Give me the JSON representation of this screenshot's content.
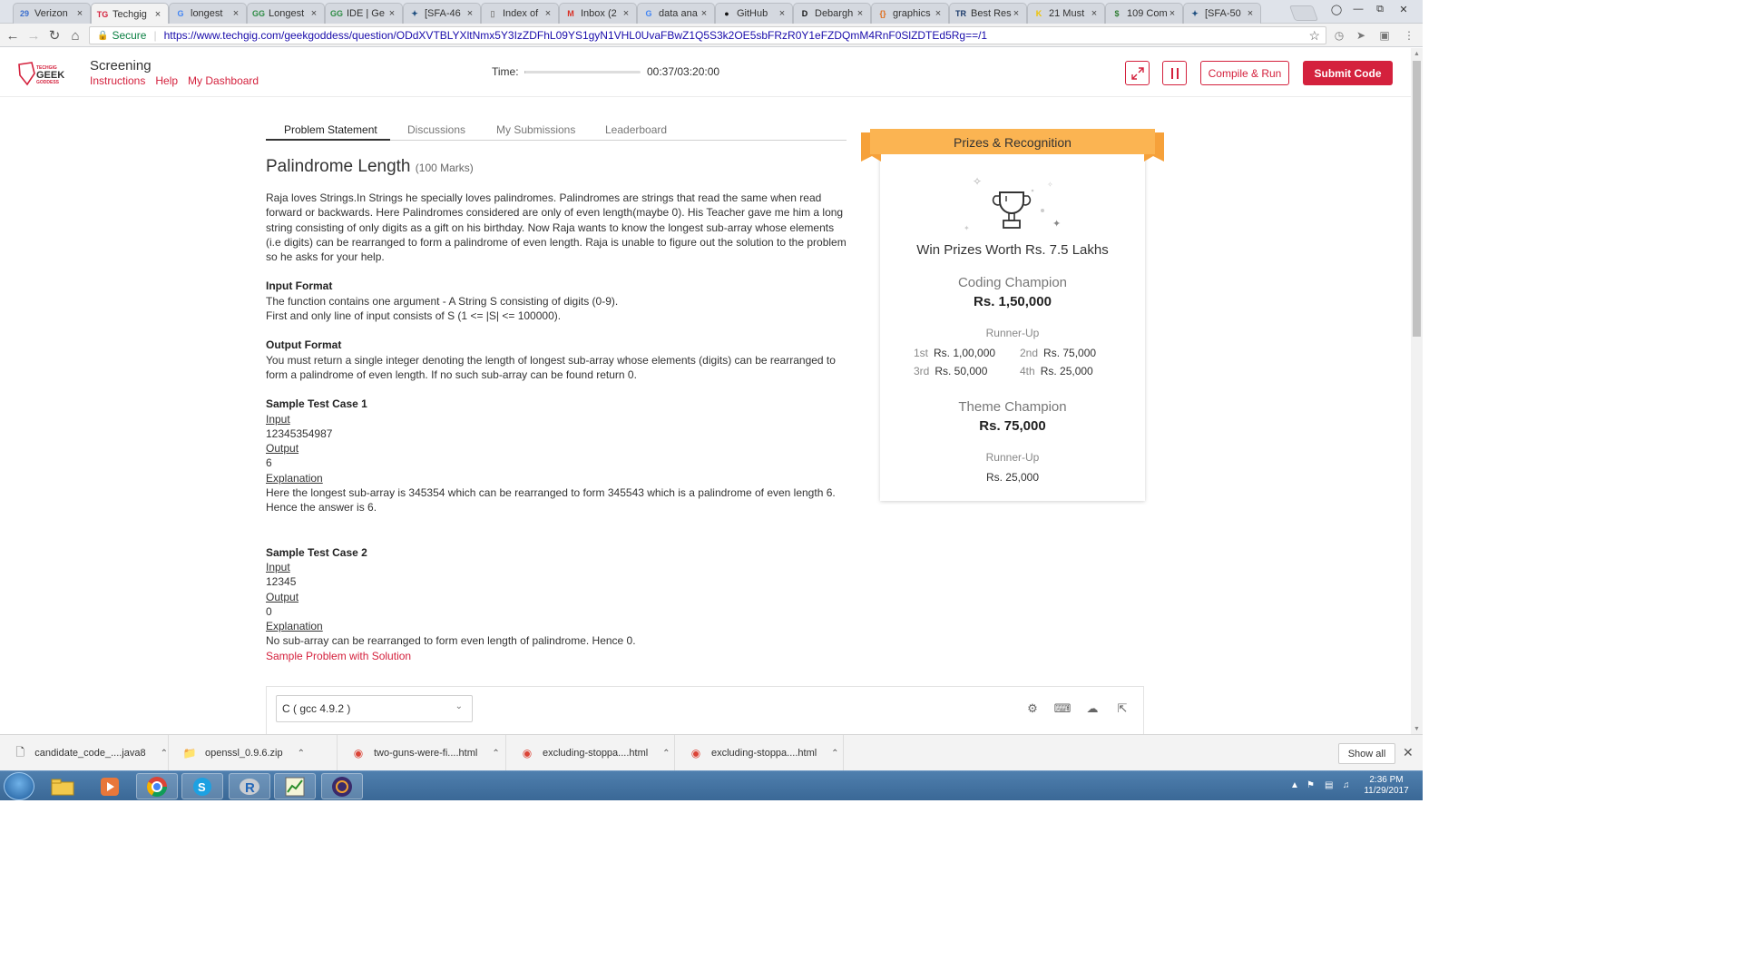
{
  "browser": {
    "tabs": [
      {
        "label": "Verizon",
        "icon": "calendar-icon",
        "color": "#3b6fcf"
      },
      {
        "label": "Techgig",
        "icon": "techgig-icon",
        "color": "#d4213d",
        "active": true
      },
      {
        "label": "longest",
        "icon": "google-icon",
        "color": "#4285f4"
      },
      {
        "label": "Longest",
        "icon": "geeks-icon",
        "color": "#2f8d46"
      },
      {
        "label": "IDE | Ge",
        "icon": "geeks-icon",
        "color": "#2f8d46"
      },
      {
        "label": "[SFA-46",
        "icon": "jira-icon",
        "color": "#205081"
      },
      {
        "label": "Index of",
        "icon": "page-icon",
        "color": "#888888"
      },
      {
        "label": "Inbox (2",
        "icon": "gmail-icon",
        "color": "#d93025"
      },
      {
        "label": "data ana",
        "icon": "google-icon",
        "color": "#4285f4"
      },
      {
        "label": "GitHub",
        "icon": "github-icon",
        "color": "#111111"
      },
      {
        "label": "Debargh",
        "icon": "d-icon",
        "color": "#111111"
      },
      {
        "label": "graphics",
        "icon": "braces-icon",
        "color": "#e06c1a"
      },
      {
        "label": "Best Res",
        "icon": "tr-icon",
        "color": "#1a3a6b"
      },
      {
        "label": "21 Must",
        "icon": "k-icon",
        "color": "#f0c400"
      },
      {
        "label": "109 Com",
        "icon": "dollar-icon",
        "color": "#2e7d32"
      },
      {
        "label": "[SFA-50",
        "icon": "jira-icon",
        "color": "#205081"
      }
    ],
    "secure_label": "Secure",
    "url": "https://www.techgig.com/geekgoddess/question/ODdXVTBLYXltNmx5Y3IzZDFhL09YS1gyN1VHL0UvaFBwZ1Q5S3k2OE5sbFRzR0Y1eFZDQmM4RnF0SlZDTEd5Rg==/1"
  },
  "header": {
    "logo_top": "TECHGIG",
    "logo_main": "GEEK",
    "logo_sub": "GODDESS",
    "title": "Screening",
    "links": [
      "Instructions",
      "Help",
      "My Dashboard"
    ],
    "time_label": "Time:",
    "time_value": "00:37/03:20:00",
    "time_progress": 0.003,
    "compile_label": "Compile & Run",
    "submit_label": "Submit Code",
    "accent": "#d4213d"
  },
  "problem_tabs": [
    "Problem Statement",
    "Discussions",
    "My Submissions",
    "Leaderboard"
  ],
  "problem": {
    "title": "Palindrome Length",
    "marks": "(100 Marks)",
    "description": "Raja loves Strings.In Strings he specially loves palindromes. Palindromes are strings that read the same when read forward or backwards. Here Palindromes considered are only of even length(maybe 0). His Teacher gave me him a long string consisting of only digits as a gift on his birthday. Now Raja wants to know the longest sub-array whose elements (i.e digits) can be rearranged to form a palindrome of even length. Raja is unable to figure out the solution to the problem so he asks for your help.",
    "input_heading": "Input Format",
    "input_line1": "The function contains one argument - A String S consisting of digits (0-9).",
    "input_line2": "First and only line of input consists of S (1 <= |S| <= 100000).",
    "output_heading": "Output Format",
    "output_text": "You must return a single integer denoting the length of longest sub-array whose elements (digits) can be rearranged to form a palindrome of even length. If no such sub-array can be found return 0.",
    "sample1": {
      "heading": "Sample Test Case 1",
      "input_label": "Input",
      "input": "12345354987",
      "output_label": "Output",
      "output": "6",
      "explanation_label": "Explanation",
      "explanation": "Here the longest sub-array is 345354 which can be rearranged to form 345543 which is a palindrome of even length 6. Hence the answer is 6."
    },
    "sample2": {
      "heading": "Sample Test Case 2",
      "input_label": "Input",
      "input": "12345",
      "output_label": "Output",
      "output": "0",
      "explanation_label": "Explanation",
      "explanation": "No sub-array can be rearranged to form even length of palindrome. Hence 0."
    },
    "solution_link": "Sample Problem with Solution"
  },
  "prizes": {
    "banner": "Prizes & Recognition",
    "headline": "Win Prizes Worth Rs. 7.5 Lakhs",
    "coding_title": "Coding Champion",
    "coding_amount": "Rs. 1,50,000",
    "runner_up_label": "Runner-Up",
    "runners": [
      {
        "rank": "1st",
        "amount": "Rs. 1,00,000"
      },
      {
        "rank": "2nd",
        "amount": "Rs. 75,000"
      },
      {
        "rank": "3rd",
        "amount": "Rs. 50,000"
      },
      {
        "rank": "4th",
        "amount": "Rs. 25,000"
      }
    ],
    "theme_title": "Theme Champion",
    "theme_amount": "Rs. 75,000",
    "theme_runner_label": "Runner-Up",
    "theme_runner_amount": "Rs. 25,000",
    "banner_color": "#fbb452"
  },
  "editor": {
    "language": "C ( gcc 4.9.2 )"
  },
  "downloads": {
    "items": [
      "candidate_code_....java8",
      "openssl_0.9.6.zip",
      "two-guns-were-fi....html",
      "excluding-stoppa....html",
      "excluding-stoppa....html"
    ],
    "show_all": "Show all"
  },
  "taskbar": {
    "time": "2:36 PM",
    "date": "11/29/2017"
  }
}
